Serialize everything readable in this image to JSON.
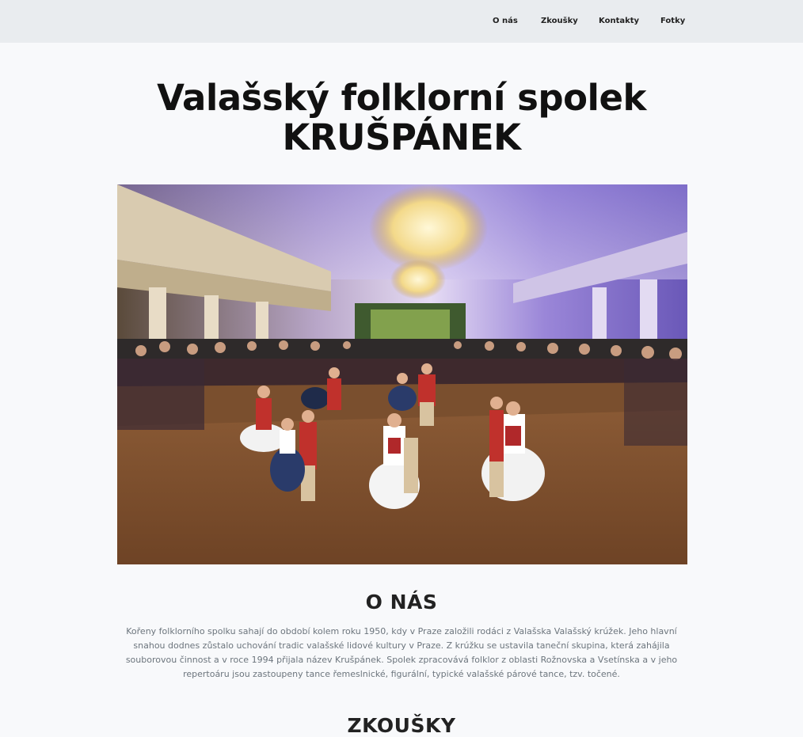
{
  "nav": {
    "items": [
      {
        "label": "O nás"
      },
      {
        "label": "Zkoušky"
      },
      {
        "label": "Kontakty"
      },
      {
        "label": "Fotky"
      }
    ]
  },
  "hero": {
    "title_line1": "Valašský folklorní spolek",
    "title_line2": "KRUŠPÁNEK",
    "image_description": "photo-folk-dancers-in-ballroom"
  },
  "about": {
    "heading": "O NÁS",
    "text": "Kořeny folklorního spolku sahají do období kolem roku 1950, kdy v Praze založili rodáci z Valašska Valašský krúžek. Jeho hlavní snahou dodnes zůstalo uchování tradic valašské lidové kultury v Praze. Z krúžku se ustavila taneční skupina, která zahájila souborovou činnost a v roce 1994 přijala název Krušpánek. Spolek zpracovává folklor z oblasti Rožnovska a Vsetínska a v jeho repertoáru jsou zastoupeny tance řemeslnické, figurální, typické valašské párové tance, tzv. točené."
  },
  "rehearsals": {
    "heading": "ZKOUŠKY"
  },
  "colors": {
    "navbar_bg": "#e9ecef",
    "page_bg": "#f8f9fb",
    "body_text": "#6c757d"
  }
}
